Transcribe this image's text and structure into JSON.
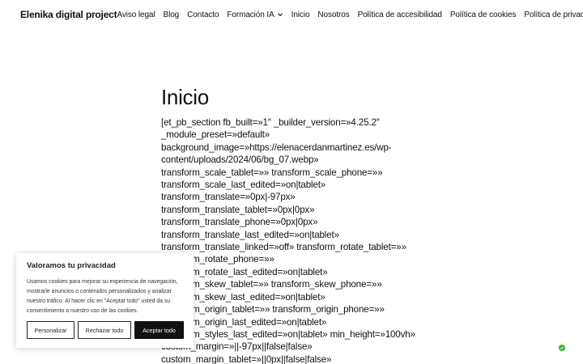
{
  "header": {
    "site_title": "Elenika digital project",
    "nav": [
      {
        "label": "Aviso legal"
      },
      {
        "label": "Blog"
      },
      {
        "label": "Contacto"
      },
      {
        "label": "Formación IA",
        "icon": "chevron-down-icon"
      },
      {
        "label": "Inicio"
      },
      {
        "label": "Nosotros"
      },
      {
        "label": "Política de accesibilidad"
      },
      {
        "label": "Política de cookies"
      },
      {
        "label": "Política de privacidad"
      }
    ]
  },
  "main": {
    "title": "Inicio",
    "lines": [
      "[et_pb_section fb_built=»1″ _builder_version=»4.25.2″",
      "_module_preset=»default»",
      "background_image=»https://elenacerdanmartinez.es/wp-",
      "content/uploads/2024/06/bg_07.webp»",
      "transform_scale_tablet=»» transform_scale_phone=»»",
      "transform_scale_last_edited=»on|tablet»",
      "transform_translate=»0px|-97px»",
      "transform_translate_tablet=»0px|0px»",
      "transform_translate_phone=»0px|0px»",
      "transform_translate_last_edited=»on|tablet»",
      "transform_translate_linked=»off» transform_rotate_tablet=»»",
      "transform_rotate_phone=»»",
      "transform_rotate_last_edited=»on|tablet»",
      "transform_skew_tablet=»» transform_skew_phone=»»",
      "transform_skew_last_edited=»on|tablet»",
      "transform_origin_tablet=»» transform_origin_phone=»»",
      "transform_origin_last_edited=»on|tablet»",
      "transform_styles_last_edited=»on|tablet» min_height=»100vh»",
      "custom_margin=»||-97px||false|false»",
      "custom_margin_tablet=»||0px||false|false»"
    ]
  },
  "cookie_banner": {
    "title": "Valoramos tu privacidad",
    "text_lines": [
      "Usamos cookies para mejorar su experiencia de navegación,",
      "mostrarle anuncios o contenidos personalizados y analizar",
      "nuestro tráfico. Al hacer clic en \"Aceptar todo\" usted da su",
      "consentimiento a nuestro uso de las cookies."
    ],
    "buttons": {
      "customize": "Personalizar",
      "reject": "Rechazar todo",
      "accept": "Aceptar todo"
    }
  },
  "widget": {
    "icon": "status-badge-icon",
    "color": "#2eb82e"
  },
  "colors": {
    "text": "#111111",
    "button_dark": "#111111",
    "background": "#ffffff"
  }
}
